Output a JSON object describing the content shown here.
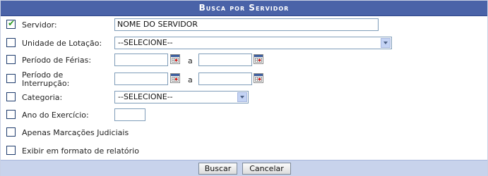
{
  "title": "Busca por Servidor",
  "fields": {
    "servidor": {
      "label": "Servidor:",
      "checked": true,
      "value": "NOME DO SERVIDOR"
    },
    "unidade": {
      "label": "Unidade de Lotação:",
      "checked": false,
      "selected": "--SELECIONE--"
    },
    "ferias": {
      "label": "Período de Férias:",
      "checked": false,
      "sep": "a"
    },
    "interrupcao": {
      "label_line1": "Período de",
      "label_line2": "Interrupção:",
      "checked": false,
      "sep": "a"
    },
    "categoria": {
      "label": "Categoria:",
      "checked": false,
      "selected": "--SELECIONE--"
    },
    "ano": {
      "label": "Ano do Exercício:",
      "checked": false,
      "value": ""
    },
    "judiciais": {
      "label": "Apenas Marcações Judiciais",
      "checked": false
    },
    "relatorio": {
      "label": "Exibir em formato de relatório",
      "checked": false
    }
  },
  "buttons": {
    "buscar": "Buscar",
    "cancelar": "Cancelar"
  },
  "icons": {
    "checkbox_checked": "check-icon",
    "calendar": "calendar-icon",
    "dropdown": "chevron-down-icon"
  },
  "colors": {
    "header": "#4a63a8",
    "footer": "#c8d3ec",
    "tick": "#2a9a22"
  }
}
